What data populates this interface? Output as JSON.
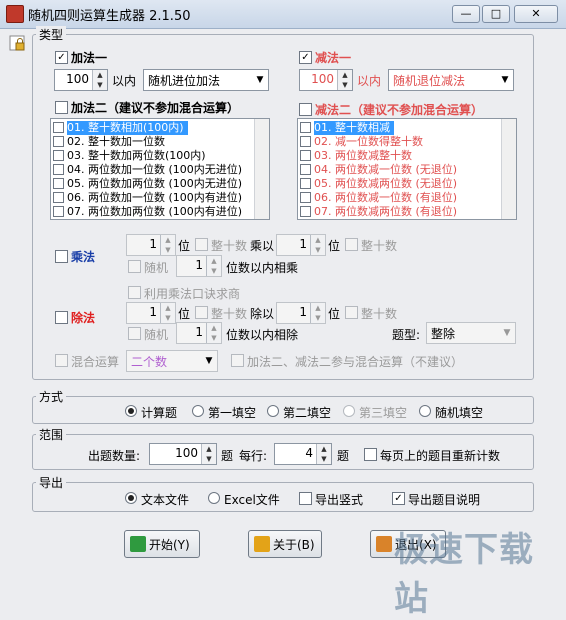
{
  "window": {
    "title": "随机四则运算生成器 2.1.50",
    "min": "—",
    "max": "□",
    "close": "✕"
  },
  "sections": {
    "type": "类型",
    "mode": "方式",
    "range": "范围",
    "export": "导出"
  },
  "add1": {
    "label": "加法一",
    "checked": true,
    "spin": "100",
    "unit": "以内",
    "combo": "随机进位加法"
  },
  "sub1": {
    "label": "减法一",
    "checked": true,
    "spin": "100",
    "unit": "以内",
    "combo": "随机退位减法"
  },
  "add2": {
    "label": "加法二（建议不参加混合运算）",
    "items": [
      "01. 整十数相加(100内)",
      "02. 整十数加一位数",
      "03. 整十数加两位数(100内)",
      "04. 两位数加一位数 (100内无进位)",
      "05. 两位数加两位数 (100内无进位)",
      "06. 两位数加一位数 (100内有进位)",
      "07. 两位数加两位数 (100内有进位)"
    ]
  },
  "sub2": {
    "label": "减法二（建议不参加混合运算）",
    "items": [
      "01. 整十数相减",
      "02. 减一位数得整十数",
      "03. 两位数减整十数",
      "04. 两位数减一位数 (无退位)",
      "05. 两位数减两位数 (无退位)",
      "06. 两位数减一位数 (有退位)",
      "07. 两位数减两位数 (有退位)"
    ]
  },
  "mul": {
    "label": "乘法",
    "a": "1",
    "wei": "位",
    "zheng": "整十数",
    "times": "乘以",
    "b": "1",
    "wei2": "位",
    "zheng2": "整十数",
    "random": "随机",
    "c": "1",
    "within": "位数以内相乘"
  },
  "div": {
    "label": "除法",
    "tip": "利用乘法口诀求商",
    "a": "1",
    "wei": "位",
    "zheng": "整十数",
    "by": "除以",
    "b": "1",
    "wei2": "位",
    "zheng2": "整十数",
    "random": "随机",
    "c": "1",
    "within": "位数以内相除",
    "qtype_label": "题型:",
    "qtype": "整除"
  },
  "mixed": {
    "label": "混合运算",
    "combo": "二个数",
    "note": "加法二、减法二参与混合运算（不建议）"
  },
  "mode": {
    "options": [
      "计算题",
      "第一填空",
      "第二填空",
      "第三填空",
      "随机填空"
    ],
    "selected": 0
  },
  "range": {
    "count_label": "出题数量:",
    "count": "100",
    "count_unit": "题",
    "perline_label": "每行:",
    "perline": "4",
    "perline_unit": "题",
    "recount": "每页上的题目重新计数"
  },
  "export": {
    "text": "文本文件",
    "excel": "Excel文件",
    "vertical": "导出竖式",
    "desc": "导出题目说明"
  },
  "buttons": {
    "start": "开始(Y)",
    "about": "关于(B)",
    "exit": "退出(X)"
  },
  "watermark": "极速下载站"
}
